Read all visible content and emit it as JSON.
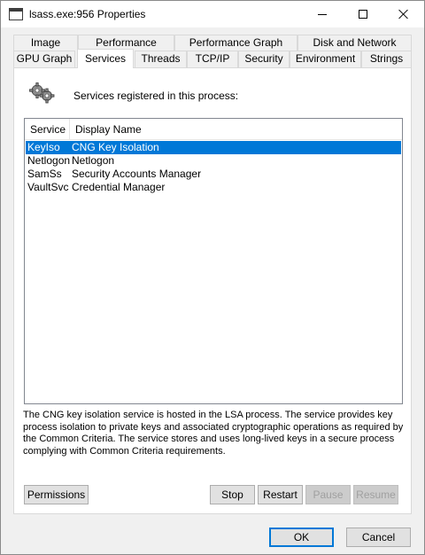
{
  "window": {
    "title": "lsass.exe:956 Properties"
  },
  "tabs": {
    "row1": [
      "Image",
      "Performance",
      "Performance Graph",
      "Disk and Network"
    ],
    "row2": [
      "GPU Graph",
      "Services",
      "Threads",
      "TCP/IP",
      "Security",
      "Environment",
      "Strings"
    ],
    "active": "Services"
  },
  "services_panel": {
    "header": "Services registered in this process:",
    "icon": "gears-icon",
    "columns": [
      "Service",
      "Display Name"
    ],
    "rows": [
      {
        "service": "KeyIso",
        "display_name": "CNG Key Isolation",
        "selected": true
      },
      {
        "service": "Netlogon",
        "display_name": "Netlogon",
        "selected": false
      },
      {
        "service": "SamSs",
        "display_name": "Security Accounts Manager",
        "selected": false
      },
      {
        "service": "VaultSvc",
        "display_name": "Credential Manager",
        "selected": false
      }
    ],
    "description": "The CNG key isolation service is hosted in the LSA process. The service provides key process isolation to private keys and associated cryptographic operations as required by the Common Criteria. The service stores and uses long-lived keys in a secure process complying with Common Criteria requirements."
  },
  "buttons": {
    "permissions": "Permissions",
    "stop": "Stop",
    "restart": "Restart",
    "pause": "Pause",
    "resume": "Resume",
    "ok": "OK",
    "cancel": "Cancel"
  },
  "colors": {
    "selection": "#0078d7",
    "dialog_bg": "#f0f0f0"
  }
}
